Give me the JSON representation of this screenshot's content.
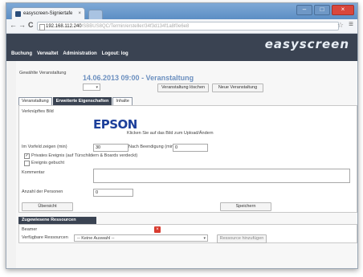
{
  "browser": {
    "tab_title": "easyscreen-Signiertafe",
    "tab_close": "×",
    "url_host": "192.168.112.240",
    "url_path": "/SBBUS8QC/Termin/ersteller/34f3d134f1a8f0e6e8",
    "minimize": "–",
    "maximize": "□",
    "close": "×",
    "back": "←",
    "forward": "→",
    "reload": "C",
    "star": "☆",
    "menu": "≡"
  },
  "app": {
    "logo": "easyscreen",
    "nav": [
      "Buchung",
      "Verwaltet",
      "Administration",
      "Logout: log"
    ]
  },
  "event": {
    "selected_label": "Gewählte Veranstaltung",
    "title": "14.06.2013 09:00 - Veranstaltung",
    "select_value": "",
    "delete_button": "Veranstaltung löschen",
    "new_button": "Neue Veranstaltung"
  },
  "tabs": [
    {
      "label": "Veranstaltung",
      "active": false
    },
    {
      "label": "Erweiterte Eigenschaften",
      "active": true
    },
    {
      "label": "Inhalte",
      "active": false
    }
  ],
  "form": {
    "image_label": "Verknüpftes Bild",
    "logo_text": "EPSON",
    "image_hint": "Klicken Sie auf das Bild zum Upload/Ändern",
    "pre_label": "Im Vorfeld zeigen (min)",
    "pre_value": "30",
    "post_label": "Nach Beendigung (min)",
    "post_value": "0",
    "checkbox1_label": "Privates Ereignis (auf Türschildern & Boards verdeckt)",
    "checkbox1_checked": "✓",
    "checkbox2_label": "Ereignis gebucht",
    "comment_label": "Kommentar",
    "participants_label": "Anzahl der Personen",
    "participants_value": "0",
    "overview_button": "Übersicht",
    "save_button": "Speichern"
  },
  "resources": {
    "header": "Zugewiesene Ressourcen",
    "assigned_item": "Beamer",
    "delete_icon": "×",
    "available_label": "Verfügbare Ressourcen",
    "available_select": "-- Keine Auswahl --",
    "add_button": "Ressource hinzufügen"
  },
  "colors": {
    "header_bg": "#3a4352",
    "title_blue": "#6b8fbf",
    "epson_blue": "#1c3f9a",
    "delete_red": "#d83a2e"
  }
}
